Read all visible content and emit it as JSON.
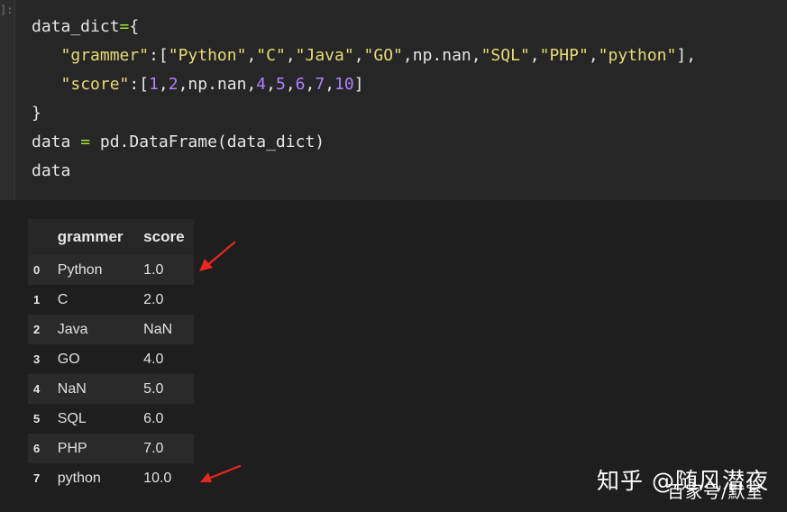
{
  "cell": {
    "prompt": "]:",
    "code_lines": [
      [
        {
          "t": "data_dict",
          "c": "plain"
        },
        {
          "t": "=",
          "c": "op"
        },
        {
          "t": "{",
          "c": "plain"
        }
      ],
      [
        {
          "t": "   ",
          "c": "plain"
        },
        {
          "t": "\"grammer\"",
          "c": "str"
        },
        {
          "t": ":[",
          "c": "plain"
        },
        {
          "t": "\"Python\"",
          "c": "str"
        },
        {
          "t": ",",
          "c": "plain"
        },
        {
          "t": "\"C\"",
          "c": "str"
        },
        {
          "t": ",",
          "c": "plain"
        },
        {
          "t": "\"Java\"",
          "c": "str"
        },
        {
          "t": ",",
          "c": "plain"
        },
        {
          "t": "\"GO\"",
          "c": "str"
        },
        {
          "t": ",np.nan,",
          "c": "plain"
        },
        {
          "t": "\"SQL\"",
          "c": "str"
        },
        {
          "t": ",",
          "c": "plain"
        },
        {
          "t": "\"PHP\"",
          "c": "str"
        },
        {
          "t": ",",
          "c": "plain"
        },
        {
          "t": "\"python\"",
          "c": "str"
        },
        {
          "t": "],",
          "c": "plain"
        }
      ],
      [
        {
          "t": "   ",
          "c": "plain"
        },
        {
          "t": "\"score\"",
          "c": "str"
        },
        {
          "t": ":[",
          "c": "plain"
        },
        {
          "t": "1",
          "c": "num"
        },
        {
          "t": ",",
          "c": "plain"
        },
        {
          "t": "2",
          "c": "num"
        },
        {
          "t": ",np.nan,",
          "c": "plain"
        },
        {
          "t": "4",
          "c": "num"
        },
        {
          "t": ",",
          "c": "plain"
        },
        {
          "t": "5",
          "c": "num"
        },
        {
          "t": ",",
          "c": "plain"
        },
        {
          "t": "6",
          "c": "num"
        },
        {
          "t": ",",
          "c": "plain"
        },
        {
          "t": "7",
          "c": "num"
        },
        {
          "t": ",",
          "c": "plain"
        },
        {
          "t": "10",
          "c": "num"
        },
        {
          "t": "]",
          "c": "plain"
        }
      ],
      [
        {
          "t": "}",
          "c": "plain"
        }
      ],
      [
        {
          "t": "data ",
          "c": "plain"
        },
        {
          "t": "=",
          "c": "op"
        },
        {
          "t": " pd.DataFrame(data_dict)",
          "c": "plain"
        }
      ],
      [
        {
          "t": "data",
          "c": "plain"
        }
      ]
    ]
  },
  "table": {
    "columns": [
      "grammer",
      "score"
    ],
    "rows": [
      {
        "index": "0",
        "grammer": "Python",
        "score": "1.0"
      },
      {
        "index": "1",
        "grammer": "C",
        "score": "2.0"
      },
      {
        "index": "2",
        "grammer": "Java",
        "score": "NaN"
      },
      {
        "index": "3",
        "grammer": "GO",
        "score": "4.0"
      },
      {
        "index": "4",
        "grammer": "NaN",
        "score": "5.0"
      },
      {
        "index": "5",
        "grammer": "SQL",
        "score": "6.0"
      },
      {
        "index": "6",
        "grammer": "PHP",
        "score": "7.0"
      },
      {
        "index": "7",
        "grammer": "python",
        "score": "10.0"
      }
    ]
  },
  "annotations": {
    "arrow_color": "#e8261e",
    "arrow_targets": [
      "row-0",
      "row-7"
    ]
  },
  "watermark": {
    "line1": "知乎 @随风潜夜",
    "line2": "百家号/默室"
  }
}
